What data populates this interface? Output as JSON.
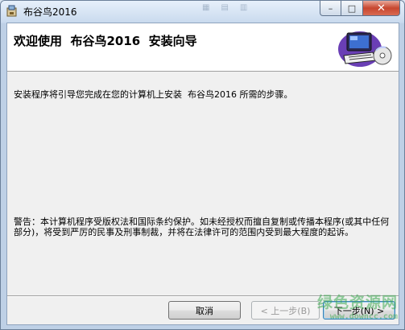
{
  "window": {
    "title": "布谷鸟2016",
    "icons": [
      "installer-icon",
      "minimize-icon",
      "maximize-icon",
      "close-icon"
    ],
    "caption": {
      "minimize": "–",
      "maximize": "□",
      "close": "✕"
    },
    "background_strip": [
      "▦",
      "▤",
      "▥"
    ]
  },
  "header": {
    "title": "欢迎使用  布谷鸟2016  安装向导",
    "art_icon": "computer-disk-icon"
  },
  "body": {
    "intro": "安装程序将引导您完成在您的计算机上安装  布谷鸟2016 所需的步骤。",
    "warning": "警告：本计算机程序受版权法和国际条约保护。如未经授权而擅自复制或传播本程序(或其中任何部分)，将受到严厉的民事及刑事制裁，并将在法律许可的范围内受到最大程度的起诉。"
  },
  "buttons": {
    "cancel": "取消",
    "back": "< 上一步(B)",
    "next": "下一步(N) >"
  },
  "watermark": {
    "text": "绿色资源网",
    "url": "www.downcc.com"
  },
  "colors": {
    "header_bg": "#ffffff",
    "client_bg": "#f0f0f0",
    "close_red": "#c7462f"
  }
}
